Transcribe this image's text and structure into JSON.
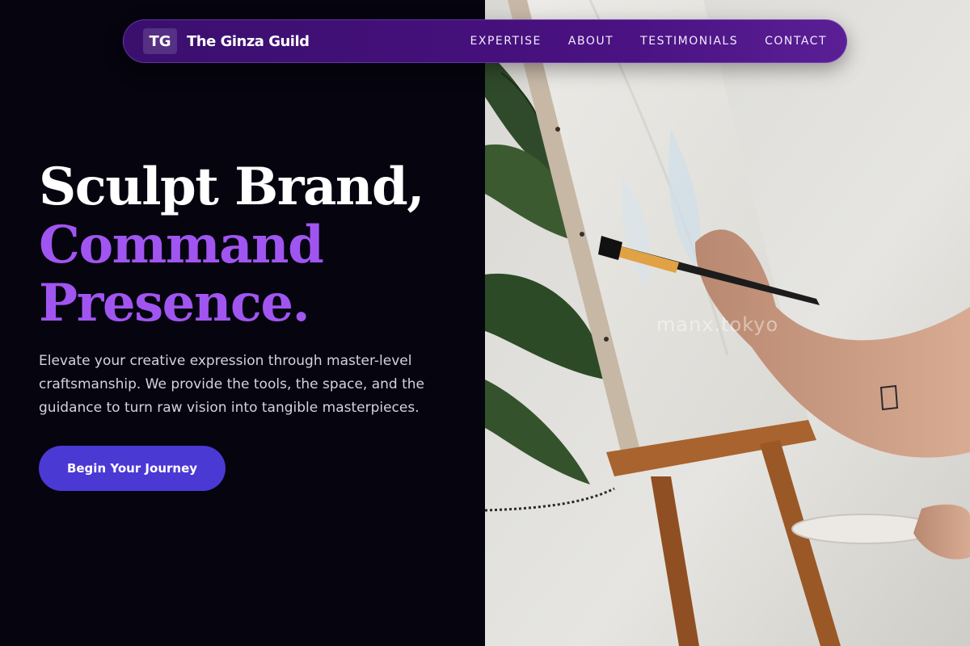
{
  "nav": {
    "logo_initials": "TG",
    "brand_name": "The Ginza Guild",
    "links": [
      "EXPERTISE",
      "ABOUT",
      "TESTIMONIALS",
      "CONTACT"
    ]
  },
  "hero": {
    "title_line1": "Sculpt Brand,",
    "title_line2": "Command",
    "title_line3": "Presence.",
    "subtitle": "Elevate your creative expression through master-level craftsmanship. We provide the tools, the space, and the guidance to turn raw vision into tangible masterpieces.",
    "cta_label": "Begin Your Journey"
  },
  "image": {
    "watermark": "manx.tokyo"
  },
  "colors": {
    "background": "#05040f",
    "accent_purple": "#a155f0",
    "button": "#4b39d4",
    "nav_gradient_start": "#3a0f6e",
    "nav_gradient_end": "#5a1f95"
  }
}
